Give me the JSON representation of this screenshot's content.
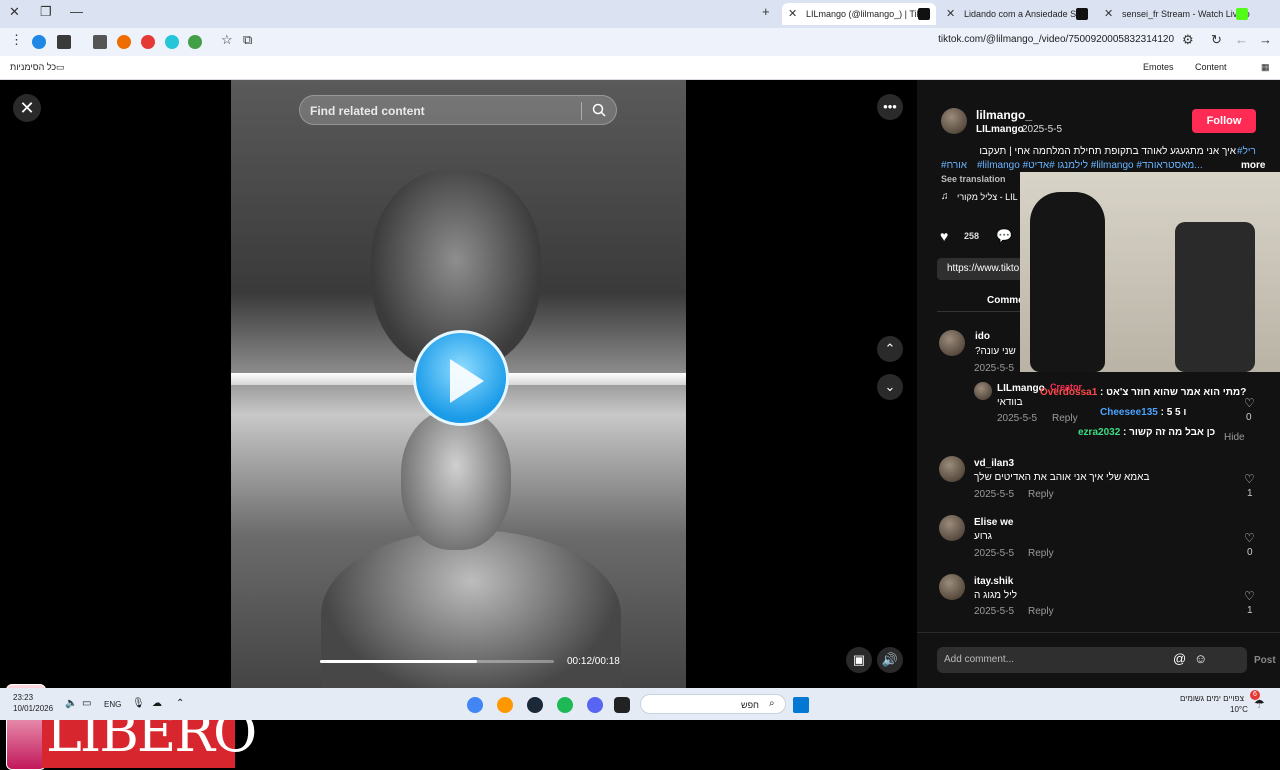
{
  "browser": {
    "tabs": [
      {
        "title": "LILmango (@lilmango_) | TikTo",
        "active": true
      },
      {
        "title": "Lidando com a Ansiedade Soci",
        "active": false
      },
      {
        "title": "sensei_fr Stream - Watch Live o",
        "active": false
      }
    ],
    "url": "tiktok.com/@lilmango_/video/7500920005832314120",
    "bookmarks_left": "כל הסימניות",
    "bookmarks_right": [
      "Emotes",
      "Content"
    ]
  },
  "player": {
    "search_placeholder": "Find related content",
    "time": "00:12/00:18",
    "progress_fraction": 0.67
  },
  "ad": {
    "brand": "LIBERO"
  },
  "post": {
    "username": "lilmango_",
    "nickname": "LILmango",
    "date": "2025-5-5",
    "follow_label": "Follow",
    "caption_line1": "איך אני מתגעגע לאוהד בתקופת תחילת המלחמה אחי | תעקבו",
    "caption_tags1": "#ריל",
    "caption_line2": "#lilmango #לילמנגו #אדיט #lilmango #מאסטראוהד...",
    "caption_tags2": "#אורח",
    "more_label": "more",
    "see_translation": "See translation",
    "sound": "צליל מקורי - LIL",
    "likes": "258",
    "link_preview": "https://www.tikto",
    "comments_tab": "Comme"
  },
  "comments": [
    {
      "user": "ido",
      "text": "שני עונה?",
      "date": "2025-5-5",
      "likes": ""
    },
    {
      "user": "LILmango",
      "badge": "Creator",
      "text": "בוודאי",
      "date": "2025-5-5",
      "reply": "Reply",
      "likes": "0"
    },
    {
      "user": "vd_ilan3",
      "text": "באמא שלי איך אני אוהב את האדיטים שלך",
      "date": "2025-5-5",
      "reply": "Reply",
      "likes": "1"
    },
    {
      "user": "Elise we",
      "text": "גרוע",
      "date": "2025-5-5",
      "reply": "Reply",
      "likes": "0"
    },
    {
      "user": "itay.shik",
      "text": "ליל מגוג ה",
      "date": "2025-5-5",
      "reply": "Reply",
      "likes": "1"
    }
  ],
  "hide_label": "Hide",
  "chat_overlay": [
    {
      "user": "Overdossa1",
      "msg": "מתי הוא אמר שהוא חוזר צ'אט?",
      "color": "#ff4b4b"
    },
    {
      "user": "Cheesee135",
      "msg": "5 5 ו",
      "color": "#4aa3ff"
    },
    {
      "user": "ezra2032",
      "msg": "כן אבל מה זה קשור",
      "color": "#3ddc84"
    }
  ],
  "add_comment": {
    "placeholder": "Add comment...",
    "post_label": "Post"
  },
  "taskbar": {
    "time": "23:23",
    "date": "10/01/2026",
    "lang": "ENG",
    "search_text": "חפש",
    "weather_text": "צפויים ימים גשומים",
    "temp": "10°C",
    "notif_count": "6"
  },
  "colors": {
    "accent": "#fe2c55",
    "tag": "#69b4ff"
  }
}
